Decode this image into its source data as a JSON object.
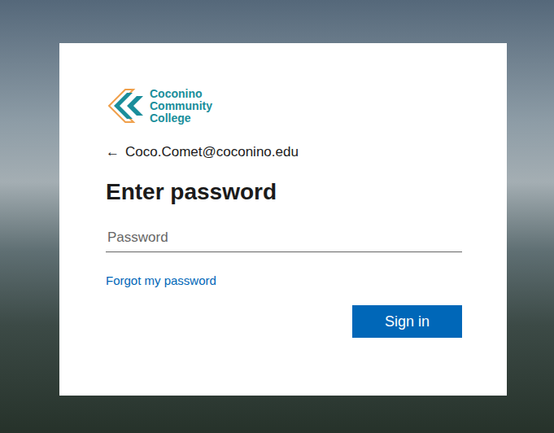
{
  "logo": {
    "lines": [
      "Coconino",
      "Community",
      "College"
    ]
  },
  "back": {
    "icon": "←"
  },
  "account": {
    "email": "Coco.Comet@coconino.edu"
  },
  "heading": "Enter password",
  "password": {
    "placeholder": "Password"
  },
  "links": {
    "forgot": "Forgot my password"
  },
  "buttons": {
    "sign_in": "Sign in"
  }
}
